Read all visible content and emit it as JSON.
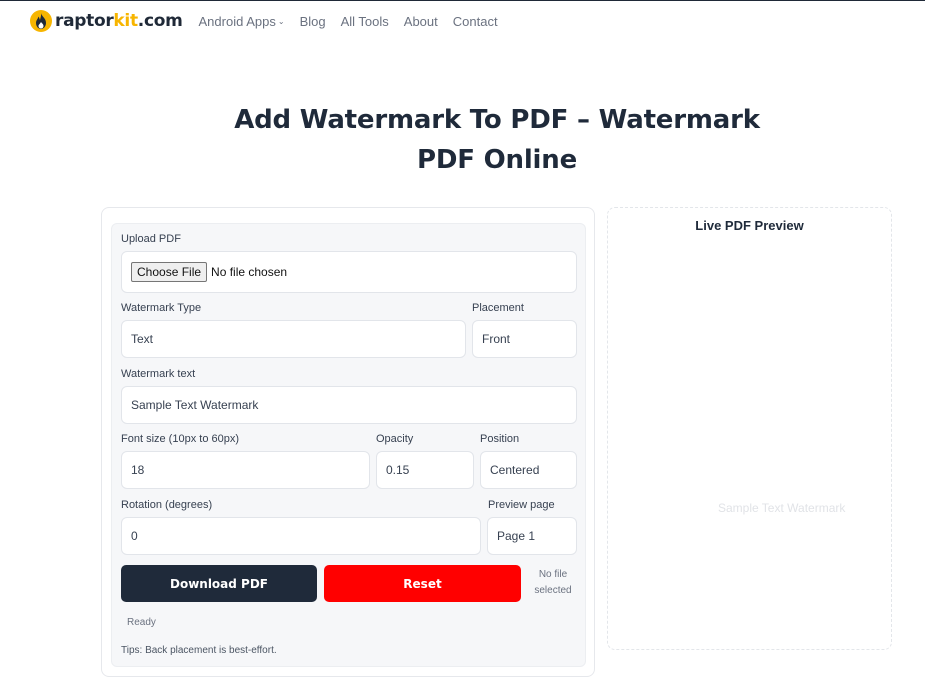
{
  "site": {
    "logo_text_1": "raptor",
    "logo_text_2": "kit",
    "logo_text_3": ".com",
    "logo_icon": "flame-icon",
    "accent_color": "#f7b500"
  },
  "nav": {
    "items": [
      {
        "label": "Android Apps",
        "has_dropdown": true
      },
      {
        "label": "Blog"
      },
      {
        "label": "All Tools"
      },
      {
        "label": "About"
      },
      {
        "label": "Contact"
      }
    ]
  },
  "page": {
    "title_line1": "Add Watermark To PDF – Watermark",
    "title_line2": "PDF Online"
  },
  "form": {
    "upload_label": "Upload PDF",
    "choose_file_label": "Choose File",
    "file_status": "No file chosen",
    "watermark_type_label": "Watermark Type",
    "watermark_type_value": "Text",
    "placement_label": "Placement",
    "placement_value": "Front",
    "watermark_text_label": "Watermark text",
    "watermark_text_value": "Sample Text Watermark",
    "font_size_label": "Font size (10px to 60px)",
    "font_size_value": "18",
    "opacity_label": "Opacity",
    "opacity_value": "0.15",
    "position_label": "Position",
    "position_value": "Centered",
    "rotation_label": "Rotation (degrees)",
    "rotation_value": "0",
    "preview_page_label": "Preview page",
    "preview_page_value": "Page 1",
    "download_label": "Download PDF",
    "reset_label": "Reset",
    "no_file_line1": "No file",
    "no_file_line2": "selected",
    "status": "Ready",
    "tips": "Tips: Back placement is best-effort.",
    "dark_button_color": "#1f2a3a",
    "reset_button_color": "#ff0000"
  },
  "preview": {
    "title": "Live PDF Preview",
    "watermark_text": "Sample Text Watermark"
  }
}
